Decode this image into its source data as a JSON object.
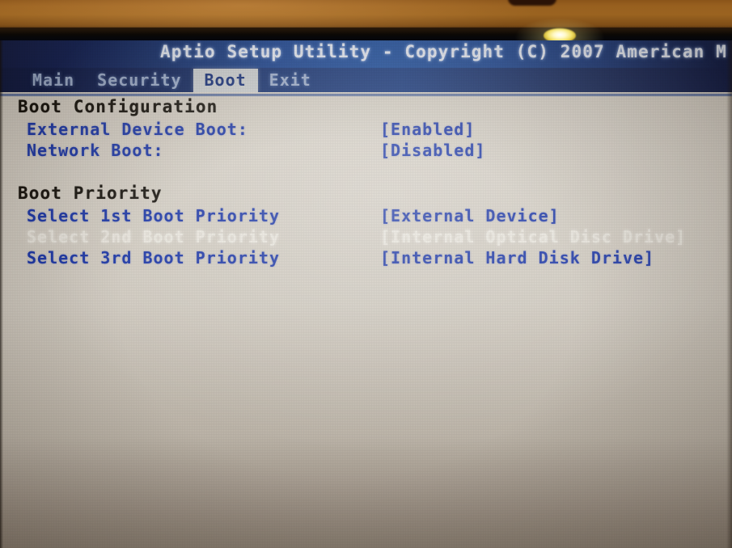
{
  "window": {
    "title": "Aptio Setup Utility - Copyright (C) 2007 American M"
  },
  "menu": {
    "items": [
      {
        "label": "Main",
        "active": false
      },
      {
        "label": "Security",
        "active": false
      },
      {
        "label": "Boot",
        "active": true
      },
      {
        "label": "Exit",
        "active": false
      }
    ]
  },
  "groups": [
    {
      "title": "Boot Configuration",
      "rows": [
        {
          "label": "External Device Boot:",
          "value": "[Enabled]",
          "faded": false
        },
        {
          "label": "Network Boot:",
          "value": "[Disabled]",
          "faded": false
        }
      ]
    },
    {
      "title": "Boot Priority",
      "rows": [
        {
          "label": "Select 1st Boot Priority",
          "value": "[External Device]",
          "faded": false
        },
        {
          "label": "Select 2nd Boot Priority",
          "value": "[Internal Optical Disc Drive]",
          "faded": true
        },
        {
          "label": "Select 3rd Boot Priority",
          "value": "[Internal Hard Disk Drive]",
          "faded": false
        }
      ]
    }
  ],
  "colors": {
    "titlebar_blue": "#1b4d9f",
    "titlebar_dark": "#101a46",
    "text_blue": "#1c37a8",
    "heading_black": "#16120c",
    "screen_bg": "#d4cec4",
    "highlight_bg": "#cfd2d4",
    "bezel_brown": "#9a6320",
    "led_amber": "#f4e26a"
  },
  "hardware": {
    "bezel_label": "laptop-bezel",
    "led_label": "power-indicator-led",
    "notch_label": "bezel-notch"
  }
}
